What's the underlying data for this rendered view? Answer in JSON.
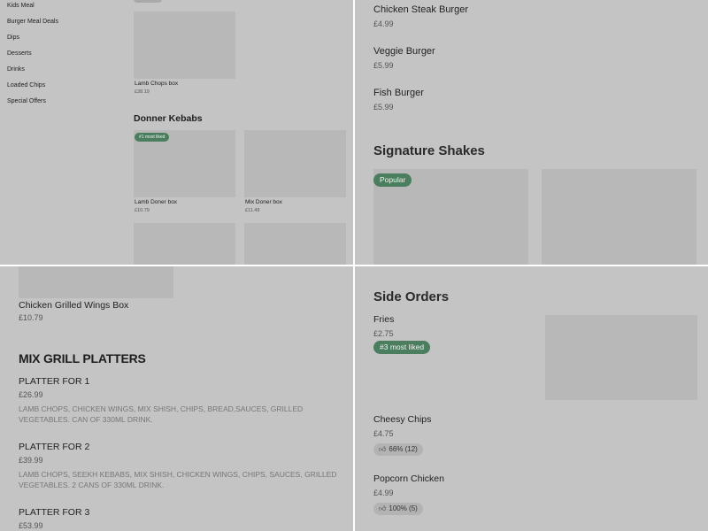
{
  "sidebar": {
    "items": [
      "Kids Meal",
      "Burger Meal Deals",
      "Dips",
      "Desserts",
      "Drinks",
      "Loaded Chips",
      "Special Offers"
    ]
  },
  "panel1": {
    "lamb_chops_box": {
      "name": "Lamb Chops box",
      "price": "£38.19"
    },
    "donner_section_title": "Donner Kebabs",
    "lamb_doner_badge": "#1 most liked",
    "lamb_doner_box": {
      "name": "Lamb Doner box",
      "price": "£10.79"
    },
    "mix_doner_box": {
      "name": "Mix Doner box",
      "price": "£11.49"
    }
  },
  "panel2": {
    "items": [
      {
        "name": "Chicken Steak Burger",
        "price": "£4.99"
      },
      {
        "name": "Veggie Burger",
        "price": "£5.99"
      },
      {
        "name": "Fish Burger",
        "price": "£5.99"
      }
    ],
    "shakes_title": "Signature Shakes",
    "shake_badge": "Popular"
  },
  "panel3": {
    "wings_box": {
      "name": "Chicken Grilled Wings Box",
      "price": "£10.79"
    },
    "platters_title": "MIX GRILL PLATTERS",
    "platters": [
      {
        "name": "PLATTER FOR 1",
        "price": "£26.99",
        "desc": "LAMB CHOPS, CHICKEN WINGS, MIX SHISH, CHIPS, BREAD,SAUCES, GRILLED VEGETABLES. CAN OF 330ML DRINK."
      },
      {
        "name": "PLATTER FOR 2",
        "price": "£39.99",
        "desc": "LAMB CHOPS, SEEKH KEBABS, MIX SHISH, CHICKEN WINGS, CHIPS, SAUCES, GRILLED VEGETABLES. 2 CANS OF 330ML DRINK."
      },
      {
        "name": "PLATTER FOR 3",
        "price": "£53.99"
      }
    ]
  },
  "panel4": {
    "title": "Side Orders",
    "fries": {
      "name": "Fries",
      "price": "£2.75",
      "badge": "#3 most liked"
    },
    "cheesy": {
      "name": "Cheesy Chips",
      "price": "£4.75",
      "rating": "66% (12)"
    },
    "popcorn": {
      "name": "Popcorn Chicken",
      "price": "£4.99",
      "rating": "100% (5)"
    }
  },
  "icons": {
    "rating": "thumbs-up-icon"
  },
  "colors": {
    "badge_bg": "#4b7d5f",
    "panel_bg": "#c4c4c4",
    "placeholder": "#b8b8b8"
  }
}
